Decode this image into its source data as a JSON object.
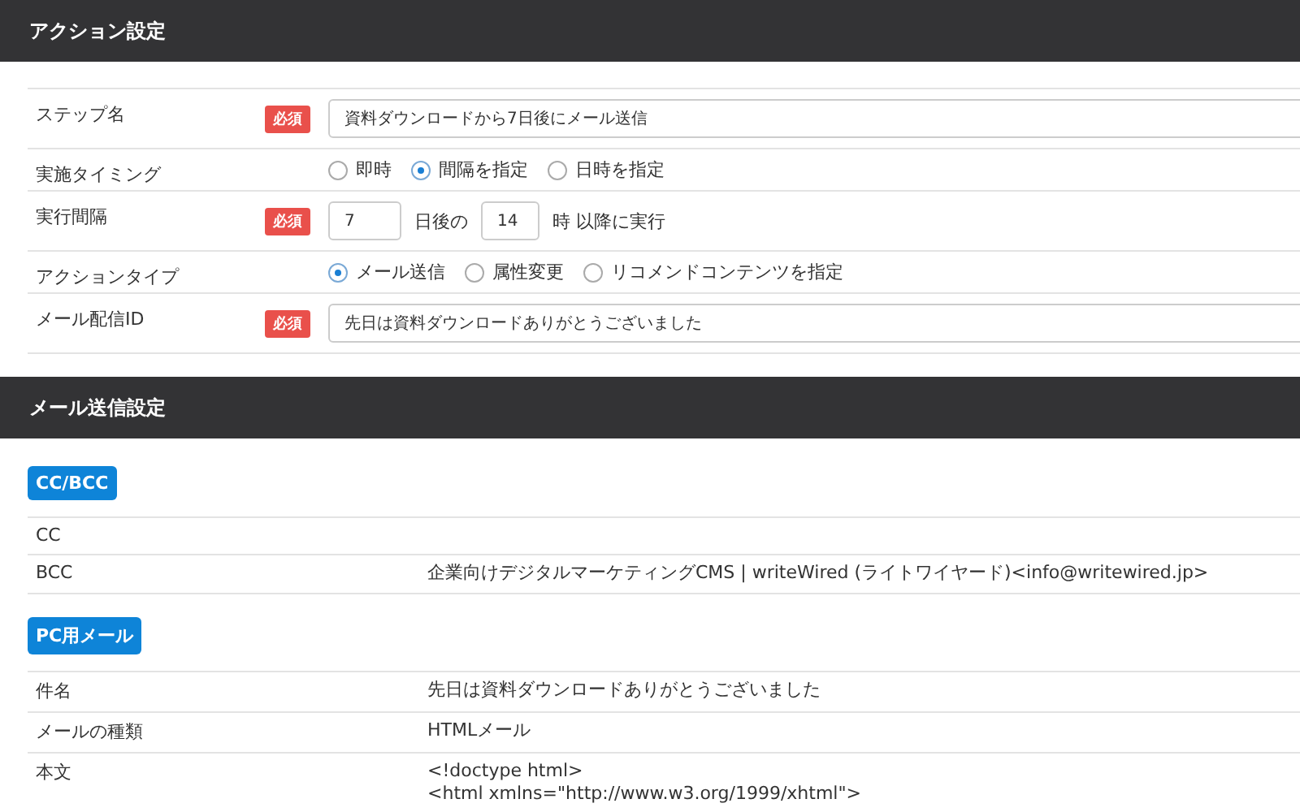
{
  "sections": [
    {
      "title": "アクション設定"
    },
    {
      "title": "メール送信設定"
    }
  ],
  "form": [
    {
      "kind": "text",
      "label": "ステップ名",
      "required": true,
      "badge": "必須",
      "value": "資料ダウンロードから7日後にメール送信"
    },
    {
      "kind": "radio",
      "label": "実施タイミング",
      "options": [
        {
          "label": "即時",
          "selected": false
        },
        {
          "label": "間隔を指定",
          "selected": true
        },
        {
          "label": "日時を指定",
          "selected": false
        }
      ]
    },
    {
      "kind": "interval",
      "label": "実行間隔",
      "required": true,
      "badge": "必須",
      "days": "7",
      "days_suffix": "日後の",
      "hours": "14",
      "hours_suffix": "時 以降に実行"
    },
    {
      "kind": "radio",
      "label": "アクションタイプ",
      "options": [
        {
          "label": "メール送信",
          "selected": true
        },
        {
          "label": "属性変更",
          "selected": false
        },
        {
          "label": "リコメンドコンテンツを指定",
          "selected": false
        }
      ]
    },
    {
      "kind": "text",
      "label": "メール配信ID",
      "required": true,
      "badge": "必須",
      "value": "先日は資料ダウンロードありがとうございました"
    }
  ],
  "groups": [
    {
      "tag": "CC/BCC",
      "rows": [
        {
          "label": "CC"
        },
        {
          "label": "BCC",
          "value": "企業向けデジタルマーケティングCMS | writeWired (ライトワイヤード)<info@writewired.jp>"
        }
      ]
    },
    {
      "tag": "PC用メール",
      "rows": [
        {
          "label": "件名",
          "value": "先日は資料ダウンロードありがとうございました"
        },
        {
          "label": "メールの種類",
          "value": "HTMLメール"
        },
        {
          "label": "本文",
          "lines": [
            "<!doctype html>",
            "<html xmlns=\"http://www.w3.org/1999/xhtml\">"
          ]
        }
      ]
    }
  ]
}
